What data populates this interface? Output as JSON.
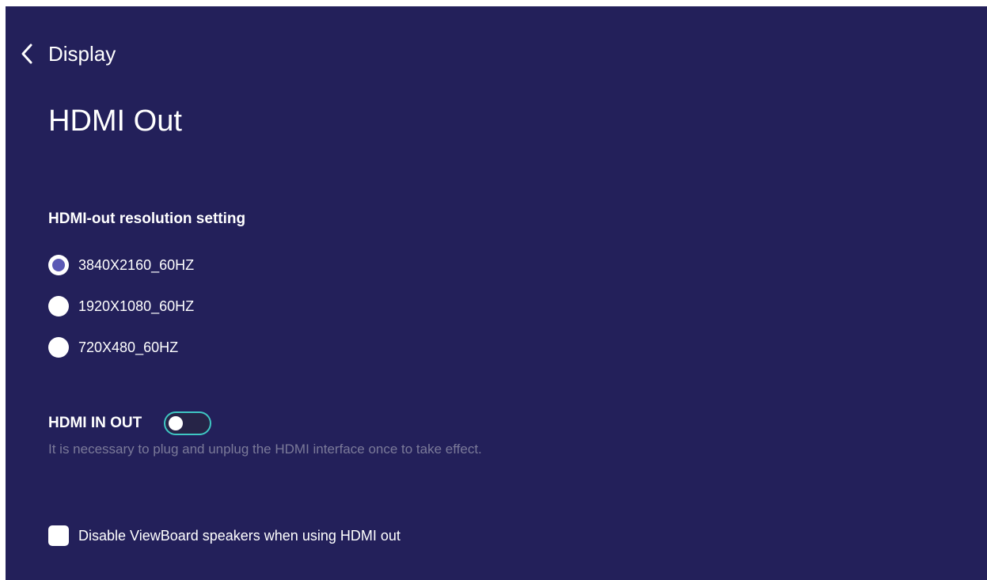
{
  "header": {
    "back_label": "Display",
    "back_icon": "chevron-left-icon"
  },
  "page": {
    "title": "HDMI Out"
  },
  "resolution": {
    "section_title": "HDMI-out resolution setting",
    "options": [
      {
        "label": "3840X2160_60HZ",
        "selected": true
      },
      {
        "label": "1920X1080_60HZ",
        "selected": false
      },
      {
        "label": "720X480_60HZ",
        "selected": false
      }
    ]
  },
  "hdmi_in_out": {
    "label": "HDMI IN OUT",
    "enabled": false,
    "hint": "It is necessary to plug and unplug the HDMI interface once to take effect."
  },
  "speakers": {
    "label": "Disable ViewBoard speakers when using HDMI out",
    "checked": false
  },
  "colors": {
    "background": "#23205a",
    "radio_selected": "#5b59b5",
    "toggle_border": "#3fc7c3",
    "hint_text": "#7b7a99"
  }
}
